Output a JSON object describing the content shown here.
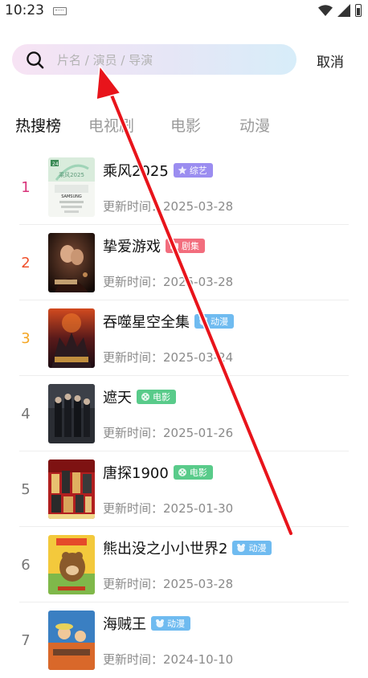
{
  "status_bar": {
    "time": "10:23"
  },
  "search": {
    "placeholder": "片名 / 演员 / 导演",
    "value": ""
  },
  "cancel_label": "取消",
  "tabs": [
    {
      "label": "热搜榜",
      "active": true
    },
    {
      "label": "电视剧",
      "active": false
    },
    {
      "label": "电影",
      "active": false
    },
    {
      "label": "动漫",
      "active": false
    }
  ],
  "items": [
    {
      "rank": "1",
      "title": "乘风2025",
      "badge": "综艺",
      "badge_color": "#9b8df0",
      "update": "更新时间：2025-03-28",
      "rank_color": "#d8337a",
      "poster_text": [
        "24",
        "乘风2025",
        "SAMSUNG"
      ]
    },
    {
      "rank": "2",
      "title": "挚爱游戏",
      "badge": "剧集",
      "badge_color": "#f26d7d",
      "update": "更新时间：2025-03-28",
      "rank_color": "#f0502b"
    },
    {
      "rank": "3",
      "title": "吞噬星空全集",
      "badge": "动漫",
      "badge_color": "#6fbbf0",
      "update": "更新时间：2025-03-24",
      "rank_color": "#f5a623"
    },
    {
      "rank": "4",
      "title": "遮天",
      "badge": "电影",
      "badge_color": "#59cb8a",
      "update": "更新时间：2025-01-26",
      "rank_color": "#777777"
    },
    {
      "rank": "5",
      "title": "唐探1900",
      "badge": "电影",
      "badge_color": "#59cb8a",
      "update": "更新时间：2025-01-30",
      "rank_color": "#777777"
    },
    {
      "rank": "6",
      "title": "熊出没之小小世界2",
      "badge": "动漫",
      "badge_color": "#6fbbf0",
      "update": "更新时间：2025-03-28",
      "rank_color": "#777777"
    },
    {
      "rank": "7",
      "title": "海贼王",
      "badge": "动漫",
      "badge_color": "#6fbbf0",
      "update": "更新时间：2024-10-10",
      "rank_color": "#777777"
    }
  ],
  "colors": {
    "arrow": "#e8141b",
    "active_tab": "#111111",
    "inactive_tab": "#9a9a9a"
  },
  "icons": {
    "search": "search-icon",
    "variety": "star-icon",
    "drama": "tv-icon",
    "anime": "bear-icon",
    "movie": "film-reel-icon"
  }
}
